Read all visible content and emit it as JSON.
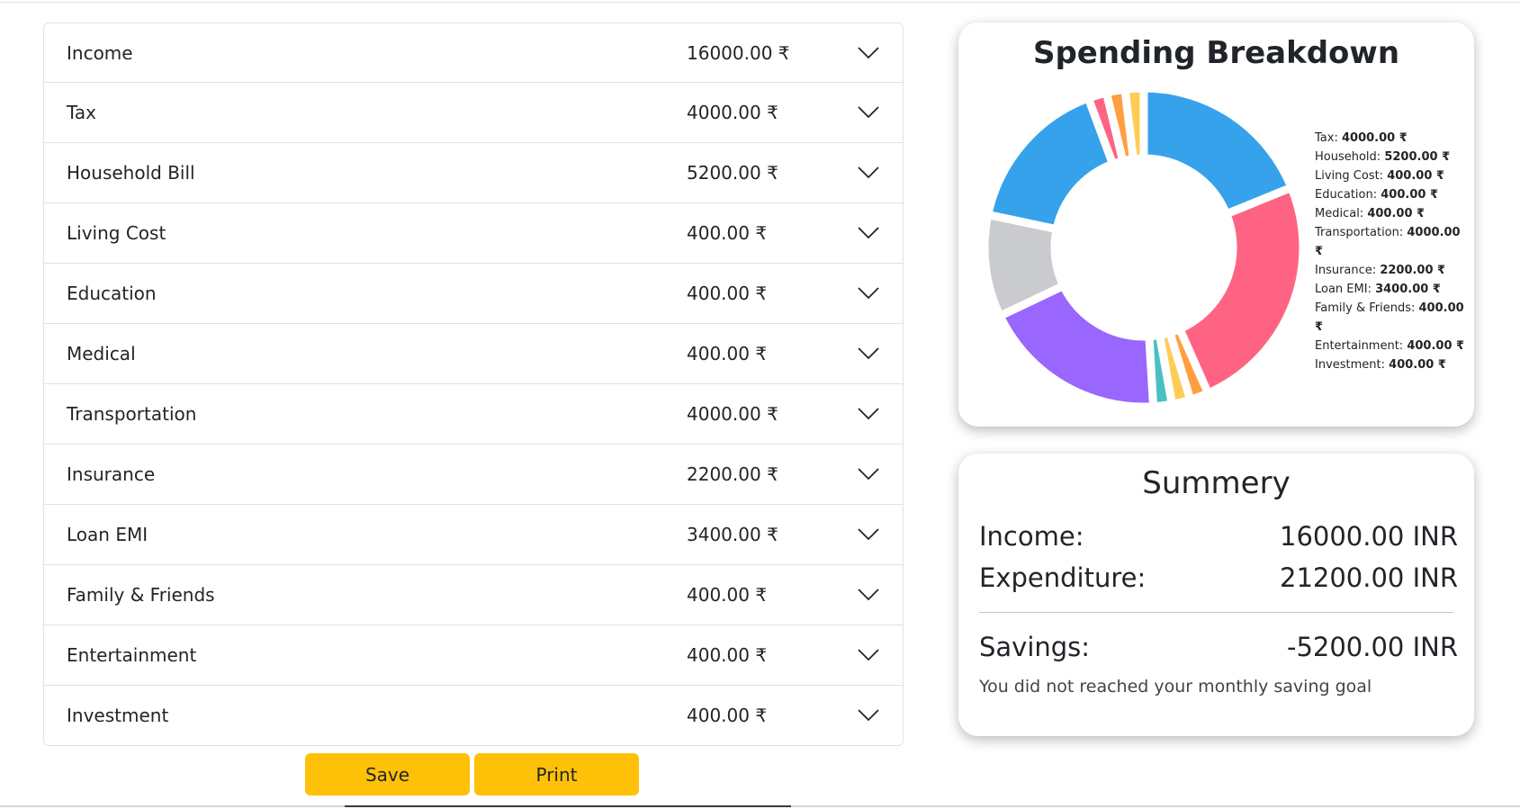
{
  "currency_symbol": "₹",
  "budget_items": [
    {
      "label": "Income",
      "amount": "16000.00 ₹"
    },
    {
      "label": "Tax",
      "amount": "4000.00 ₹"
    },
    {
      "label": "Household Bill",
      "amount": "5200.00 ₹"
    },
    {
      "label": "Living Cost",
      "amount": "400.00 ₹"
    },
    {
      "label": "Education",
      "amount": "400.00 ₹"
    },
    {
      "label": "Medical",
      "amount": "400.00 ₹"
    },
    {
      "label": "Transportation",
      "amount": "4000.00 ₹"
    },
    {
      "label": "Insurance",
      "amount": "2200.00 ₹"
    },
    {
      "label": "Loan EMI",
      "amount": "3400.00 ₹"
    },
    {
      "label": "Family & Friends",
      "amount": "400.00 ₹"
    },
    {
      "label": "Entertainment",
      "amount": "400.00 ₹"
    },
    {
      "label": "Investment",
      "amount": "400.00 ₹"
    }
  ],
  "buttons": {
    "save": "Save",
    "print": "Print"
  },
  "chart": {
    "title": "Spending Breakdown",
    "legend": [
      {
        "label": "Tax:",
        "value": "4000.00 ₹"
      },
      {
        "label": "Household:",
        "value": "5200.00 ₹"
      },
      {
        "label": "Living Cost:",
        "value": "400.00 ₹"
      },
      {
        "label": "Education:",
        "value": "400.00 ₹"
      },
      {
        "label": "Medical:",
        "value": "400.00 ₹"
      },
      {
        "label": "Transportation:",
        "value": "4000.00 ₹"
      },
      {
        "label": "Insurance:",
        "value": "2200.00 ₹"
      },
      {
        "label": "Loan EMI:",
        "value": "3400.00 ₹"
      },
      {
        "label": "Family & Friends:",
        "value": "400.00 ₹"
      },
      {
        "label": "Entertainment:",
        "value": "400.00 ₹"
      },
      {
        "label": "Investment:",
        "value": "400.00 ₹"
      }
    ]
  },
  "chart_data": {
    "type": "pie",
    "title": "Spending Breakdown",
    "categories": [
      "Tax",
      "Household",
      "Living Cost",
      "Education",
      "Medical",
      "Transportation",
      "Insurance",
      "Loan EMI",
      "Family & Friends",
      "Entertainment",
      "Investment"
    ],
    "values": [
      4000,
      5200,
      400,
      400,
      400,
      4000,
      2200,
      3400,
      400,
      400,
      400
    ],
    "colors": [
      "#36a2eb",
      "#ff6384",
      "#ff9f40",
      "#ffcd56",
      "#4bc0c0",
      "#9966ff",
      "#c9cbcf",
      "#36a2eb",
      "#ff6384",
      "#ff9f40",
      "#ffcd56"
    ],
    "legend_position": "right"
  },
  "summary": {
    "title": "Summery",
    "income_label": "Income:",
    "income_value": "16000.00 INR",
    "expenditure_label": "Expenditure:",
    "expenditure_value": "21200.00 INR",
    "savings_label": "Savings:",
    "savings_value": "-5200.00 INR",
    "note": "You did not reached your monthly saving goal"
  }
}
